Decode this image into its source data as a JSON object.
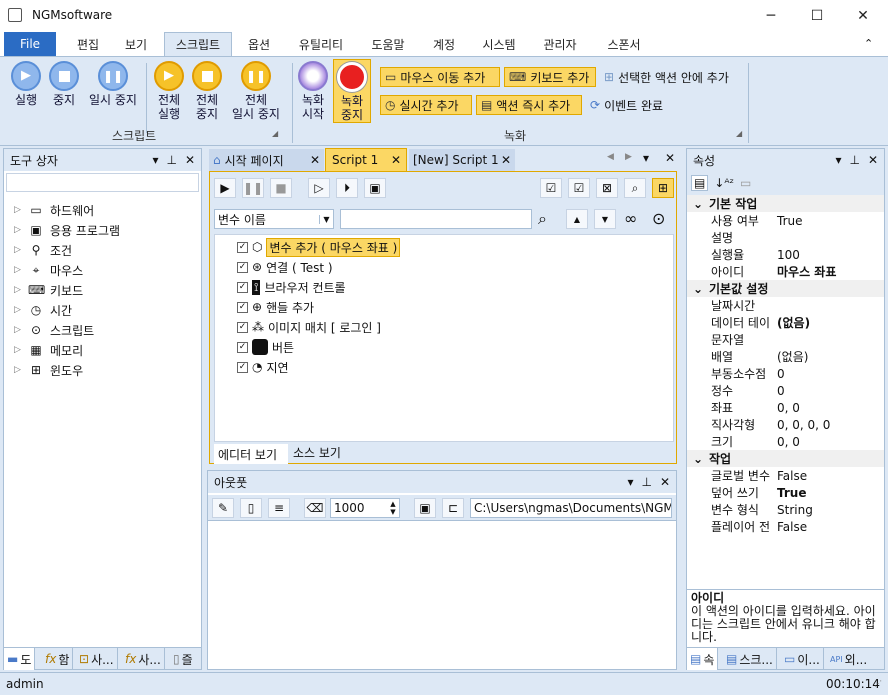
{
  "app": {
    "title": "NGMsoftware"
  },
  "menu": [
    "File",
    "편집",
    "보기",
    "스크립트",
    "옵션",
    "유틸리티",
    "도움말",
    "계정",
    "시스템",
    "관리자",
    "스폰서"
  ],
  "ribbon": {
    "run": "실행",
    "stop": "중지",
    "pause": "일시 중지",
    "all_run_1": "전체",
    "all_run_2": "실행",
    "all_stop_1": "전체",
    "all_stop_2": "중지",
    "all_pause_1": "전체",
    "all_pause_2": "일시 중지",
    "script_group": "스크립트",
    "rec_start_1": "녹화",
    "rec_start_2": "시작",
    "rec_stop_1": "녹화",
    "rec_stop_2": "중지",
    "add_mouse_move": "마우스 이동 추가",
    "add_keyboard": "키보드 추가",
    "add_in_selected": "선택한 액션 안에 추가",
    "add_realtime": "실시간 추가",
    "add_action_now": "액션 즉시 추가",
    "event_done": "이벤트 완료",
    "record_group": "녹화"
  },
  "toolbox": {
    "title": "도구 상자",
    "items": [
      "하드웨어",
      "응용 프로그램",
      "조건",
      "마우스",
      "키보드",
      "시간",
      "스크립트",
      "메모리",
      "윈도우"
    ],
    "bottom_tabs": [
      "도",
      "함",
      "사...",
      "사...",
      "즐"
    ]
  },
  "editor": {
    "tabs": [
      "시작 페이지",
      "Script 1",
      "[New] Script 1"
    ],
    "var_select": "변수 이름",
    "nodes": [
      "변수 추가 ( 마우스 좌표 )",
      "연결 ( Test )",
      "브라우저 컨트롤",
      "핸들 추가",
      "이미지 매치 [ 로그인 ]",
      "버튼",
      "지연"
    ],
    "view_tabs": [
      "에디터 보기",
      "소스 보기"
    ]
  },
  "output": {
    "title": "아웃풋",
    "count": "1000",
    "path": "C:\\Users\\ngmas\\Documents\\NGM6\\"
  },
  "properties": {
    "title": "속성",
    "cat1": "기본 작업",
    "rows1": [
      [
        "사용 여부",
        "True"
      ],
      [
        "설명",
        ""
      ],
      [
        "실행율",
        "100"
      ],
      [
        "아이디",
        "마우스 좌표"
      ]
    ],
    "cat2": "기본값 설정",
    "rows2": [
      [
        "날짜시간",
        ""
      ],
      [
        "데이터 테이",
        "(없음)"
      ],
      [
        "문자열",
        ""
      ],
      [
        "배열",
        "(없음)"
      ],
      [
        "부동소수점",
        "0"
      ],
      [
        "정수",
        "0"
      ],
      [
        "좌표",
        "0, 0"
      ],
      [
        "직사각형",
        "0, 0, 0, 0"
      ],
      [
        "크기",
        "0, 0"
      ]
    ],
    "cat3": "작업",
    "rows3": [
      [
        "글로벌 변수",
        "False"
      ],
      [
        "덮어 쓰기",
        "True"
      ],
      [
        "변수 형식",
        "String"
      ],
      [
        "플레이어 전",
        "False"
      ]
    ],
    "desc_title": "아이디",
    "desc_text": "이 액션의 아이디를 입력하세요. 아이디는 스크립트 안에서 유니크 해야 합니다.",
    "bottom_tabs": [
      "속",
      "스크...",
      "이...",
      "외..."
    ]
  },
  "status": {
    "user": "admin",
    "time": "00:10:14"
  }
}
